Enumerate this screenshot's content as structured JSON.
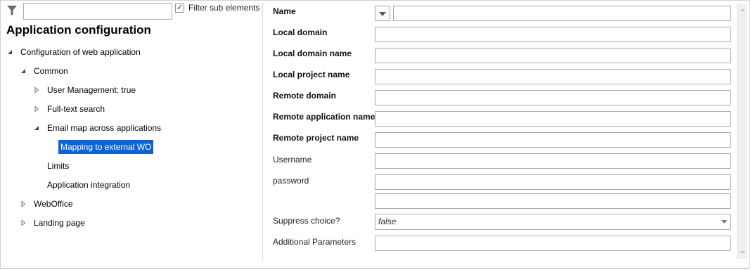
{
  "filter": {
    "placeholder": "",
    "checkbox_checked": true,
    "checkbox_label": "Filter sub elements"
  },
  "panel": {
    "title": "Application configuration"
  },
  "tree": {
    "root": "Configuration of web application",
    "common": "Common",
    "user_management": "User Management: true",
    "fulltext": "Full-text search",
    "email_map": "Email map across applications",
    "mapping": "Mapping to external WO",
    "limits": "Limits",
    "app_integration": "Application integration",
    "weboffice": "WebOffice",
    "landing": "Landing page"
  },
  "form": {
    "name_label": "Name",
    "local_domain_label": "Local domain",
    "local_domain_name_label": "Local domain name",
    "local_project_name_label": "Local project name",
    "remote_domain_label": "Remote domain",
    "remote_app_name_label": "Remote application name",
    "remote_project_name_label": "Remote project name",
    "username_label": "Username",
    "password_label": "password",
    "suppress_label": "Suppress choice?",
    "suppress_value": "false",
    "additional_label": "Additional Parameters"
  },
  "colors": {
    "selection": "#0a64d6"
  }
}
